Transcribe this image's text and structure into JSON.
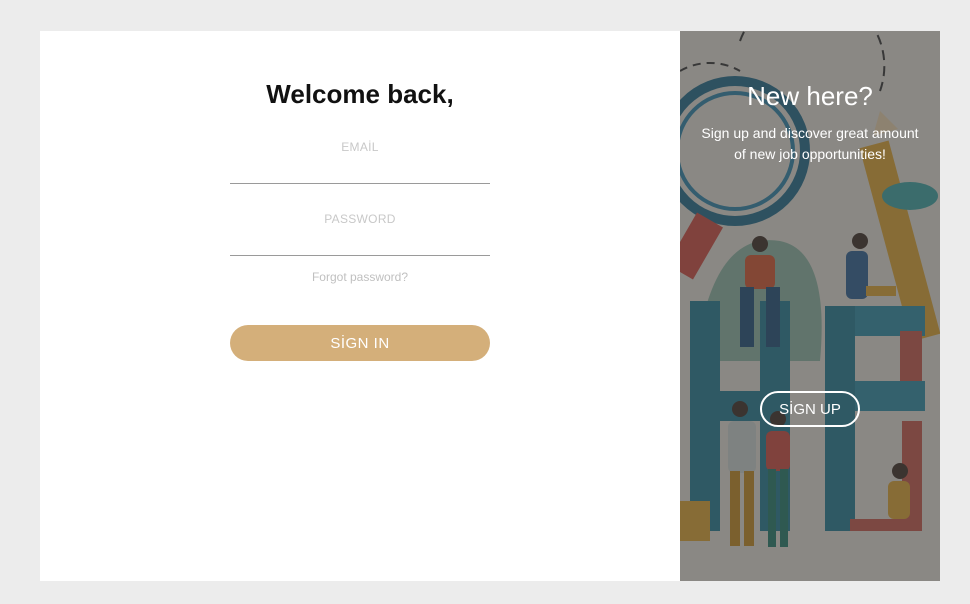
{
  "signin_panel": {
    "title": "Welcome back,",
    "email_label": "EMAİL",
    "email_value": "",
    "password_label": "PASSWORD",
    "password_value": "",
    "forgot_link": "Forgot password?",
    "signin_button": "SİGN IN"
  },
  "signup_panel": {
    "title": "New here?",
    "text": "Sign up and discover great amount of new job opportunities!",
    "signup_button": "SİGN UP"
  },
  "colors": {
    "page_bg": "#ececec",
    "card_bg": "#ffffff",
    "signin_button": "#d4af7a",
    "overlay": "#6a6a6a"
  }
}
